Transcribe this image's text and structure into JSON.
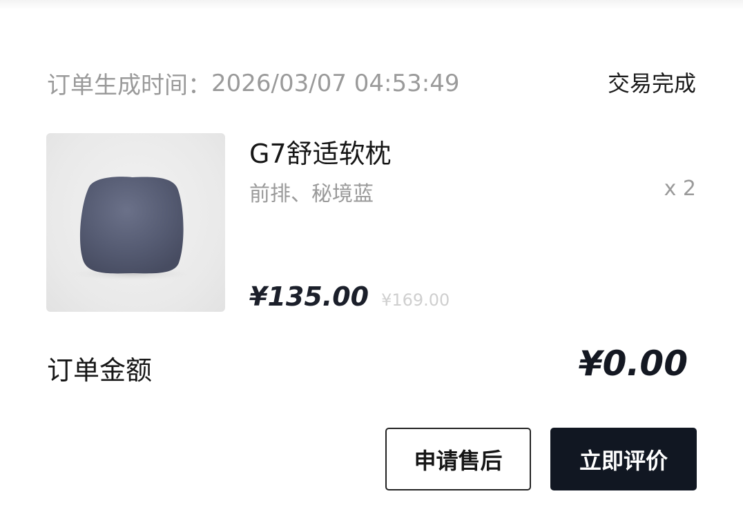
{
  "order": {
    "time_label": "订单生成时间：",
    "time_value": "2026/03/07 04:53:49",
    "status": "交易完成"
  },
  "product": {
    "name": "G7舒适软枕",
    "spec": "前排、秘境蓝",
    "quantity": "x 2",
    "price": "¥135.00",
    "original_price": "¥169.00",
    "image_icon": "pillow-image",
    "image_color": "#5b6177"
  },
  "total": {
    "label": "订单金额",
    "amount": "¥0.00"
  },
  "actions": {
    "after_sale_label": "申请售后",
    "review_label": "立即评价"
  },
  "colors": {
    "primary_button": "#111722",
    "muted_text": "#9a9a9a"
  }
}
